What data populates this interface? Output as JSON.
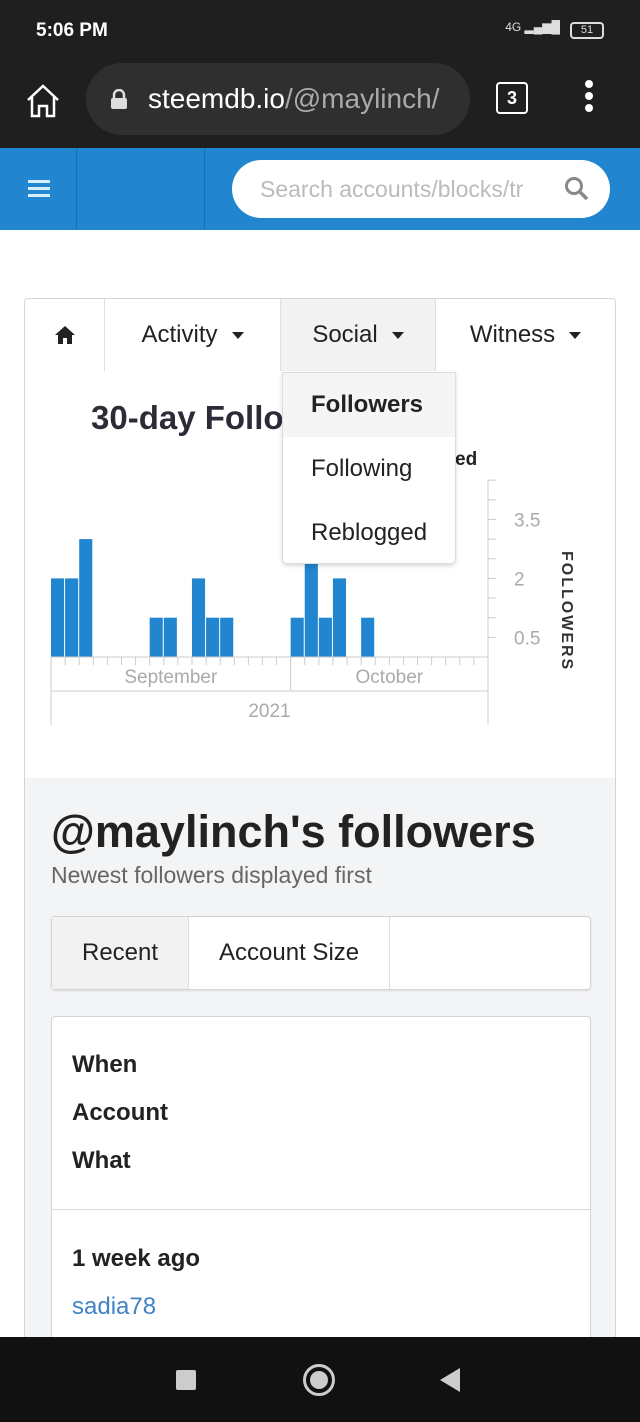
{
  "status_bar": {
    "time": "5:06 PM",
    "network": "4G",
    "battery": "51"
  },
  "browser": {
    "url_domain": "steemdb.io",
    "url_path": "/@maylinch/",
    "tab_count": "3"
  },
  "navbar": {
    "search_placeholder": "Search accounts/blocks/tr",
    "accent": "#2185d0"
  },
  "menu": {
    "items": [
      {
        "label": "Activity"
      },
      {
        "label": "Social"
      },
      {
        "label": "Witness"
      }
    ],
    "active": "Social"
  },
  "dropdown": {
    "items": [
      "Followers",
      "Following",
      "Reblogged"
    ],
    "selected": "Followers"
  },
  "chart": {
    "title_visible": "30-day Follo",
    "legend_visible": "ed",
    "y_label": "FOLLOWERS"
  },
  "chart_data": {
    "type": "bar",
    "x_labels": [
      "September",
      "October"
    ],
    "x_year": "2021",
    "day_count": 31,
    "bars": [
      {
        "i": 0,
        "v": 2
      },
      {
        "i": 1,
        "v": 2
      },
      {
        "i": 2,
        "v": 3
      },
      {
        "i": 7,
        "v": 1
      },
      {
        "i": 8,
        "v": 1
      },
      {
        "i": 10,
        "v": 2
      },
      {
        "i": 11,
        "v": 1
      },
      {
        "i": 12,
        "v": 1
      },
      {
        "i": 17,
        "v": 1
      },
      {
        "i": 18,
        "v": 3
      },
      {
        "i": 19,
        "v": 1
      },
      {
        "i": 20,
        "v": 2
      },
      {
        "i": 22,
        "v": 1
      }
    ],
    "october_start_index": 17,
    "y_ticks": [
      "0.5",
      "2",
      "3.5"
    ],
    "ylim": [
      0,
      4.5
    ],
    "bar_color": "#2185d0"
  },
  "followers": {
    "heading": "@maylinch's followers",
    "subheading": "Newest followers displayed first",
    "tabs": [
      "Recent",
      "Account Size"
    ],
    "columns": [
      "When",
      "Account",
      "What"
    ],
    "rows": [
      {
        "when": "1 week ago",
        "account": "sadia78"
      }
    ]
  }
}
